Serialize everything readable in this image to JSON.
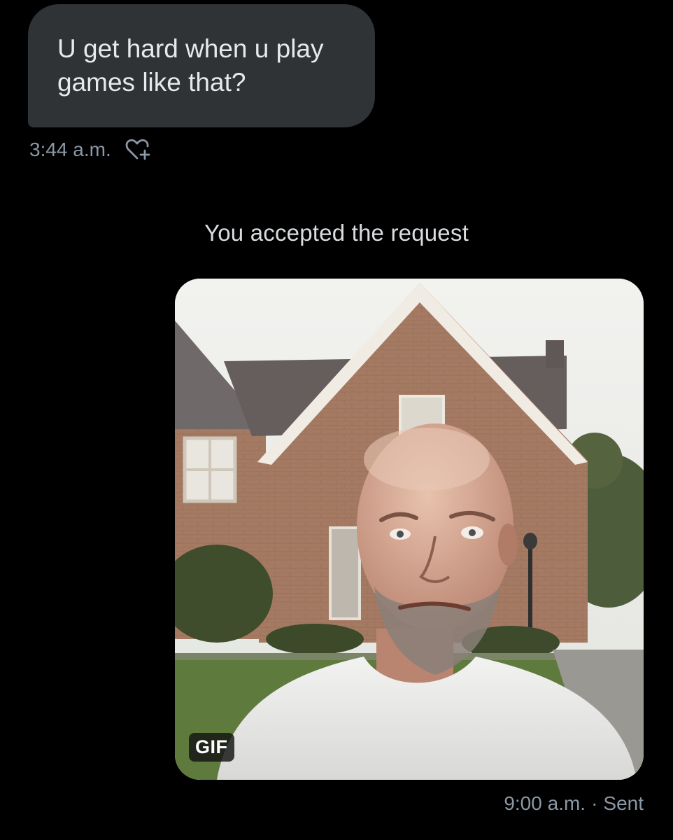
{
  "incoming_message": {
    "text_line1": "U get hard when u play",
    "text_line2": "games like that?",
    "timestamp": "3:44 a.m.",
    "react_icon": "heart-plus-icon"
  },
  "system_note": "You accepted the request",
  "outgoing_message": {
    "media_type_badge": "GIF",
    "timestamp": "9:00 a.m.",
    "separator": "·",
    "status": "Sent"
  },
  "colors": {
    "background": "#000000",
    "bubble": "#2f3336",
    "secondary_text": "#8b98a5"
  }
}
